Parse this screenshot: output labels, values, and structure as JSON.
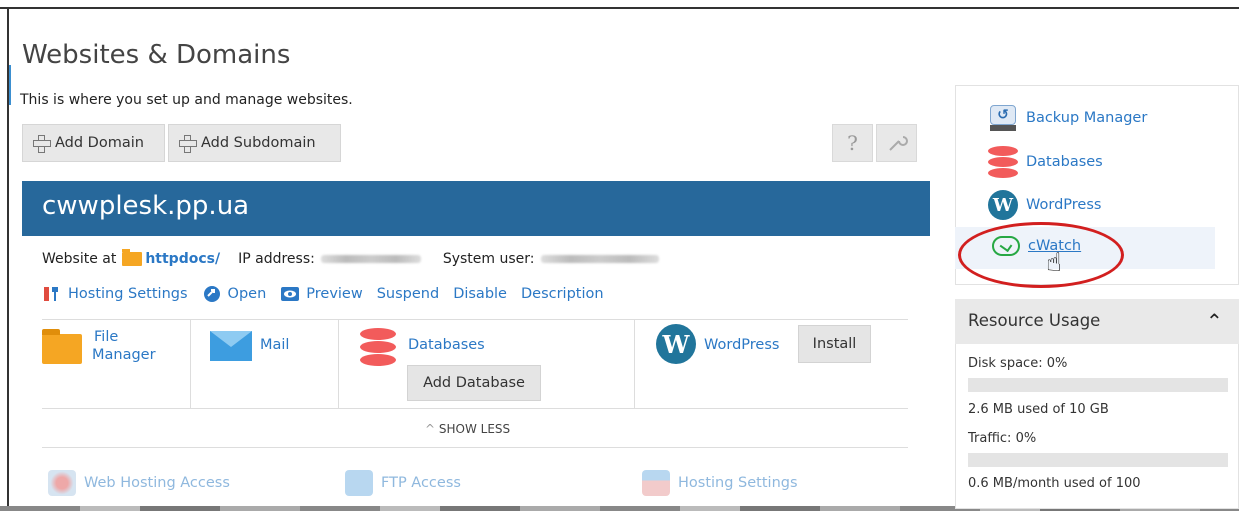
{
  "page": {
    "title": "Websites & Domains",
    "subtitle": "This is where you set up and manage websites."
  },
  "toolbar": {
    "add_domain": "Add Domain",
    "add_subdomain": "Add Subdomain",
    "help_icon": "question-icon",
    "settings_icon": "wrench-icon"
  },
  "domain": {
    "name": "cwwplesk.pp.ua",
    "website_at_label": "Website at",
    "docroot": "httpdocs/",
    "ip_label": "IP address:",
    "system_user_label": "System user:",
    "actions": {
      "hosting_settings": "Hosting Settings",
      "open": "Open",
      "preview": "Preview",
      "suspend": "Suspend",
      "disable": "Disable",
      "description": "Description"
    },
    "cards": {
      "file_manager_line1": "File",
      "file_manager_line2": "Manager",
      "mail": "Mail",
      "databases": "Databases",
      "add_database": "Add Database",
      "wordpress": "WordPress",
      "install": "Install"
    },
    "show_less": "SHOW LESS",
    "more": {
      "web_hosting_access": "Web Hosting Access",
      "ftp_access": "FTP Access",
      "hosting_settings": "Hosting Settings"
    }
  },
  "sidebar": {
    "items": [
      {
        "label": "Backup Manager",
        "icon": "backup-icon"
      },
      {
        "label": "Databases",
        "icon": "database-icon"
      },
      {
        "label": "WordPress",
        "icon": "wordpress-icon"
      },
      {
        "label": "cWatch",
        "icon": "cloud-check-icon"
      }
    ]
  },
  "resource_usage": {
    "title": "Resource Usage",
    "disk_label": "Disk space: ",
    "disk_value": "0%",
    "disk_fraction": 0.0,
    "disk_detail": "2.6 MB used of 10 GB",
    "traffic_label": "Traffic: ",
    "traffic_value": "0%",
    "traffic_fraction": 0.0,
    "traffic_detail": "0.6 MB/month used of 100"
  },
  "colors": {
    "header_blue": "#27689b",
    "link_blue": "#2b78c5",
    "highlight_red": "#d21f1f",
    "cwatch_green": "#27a844"
  }
}
